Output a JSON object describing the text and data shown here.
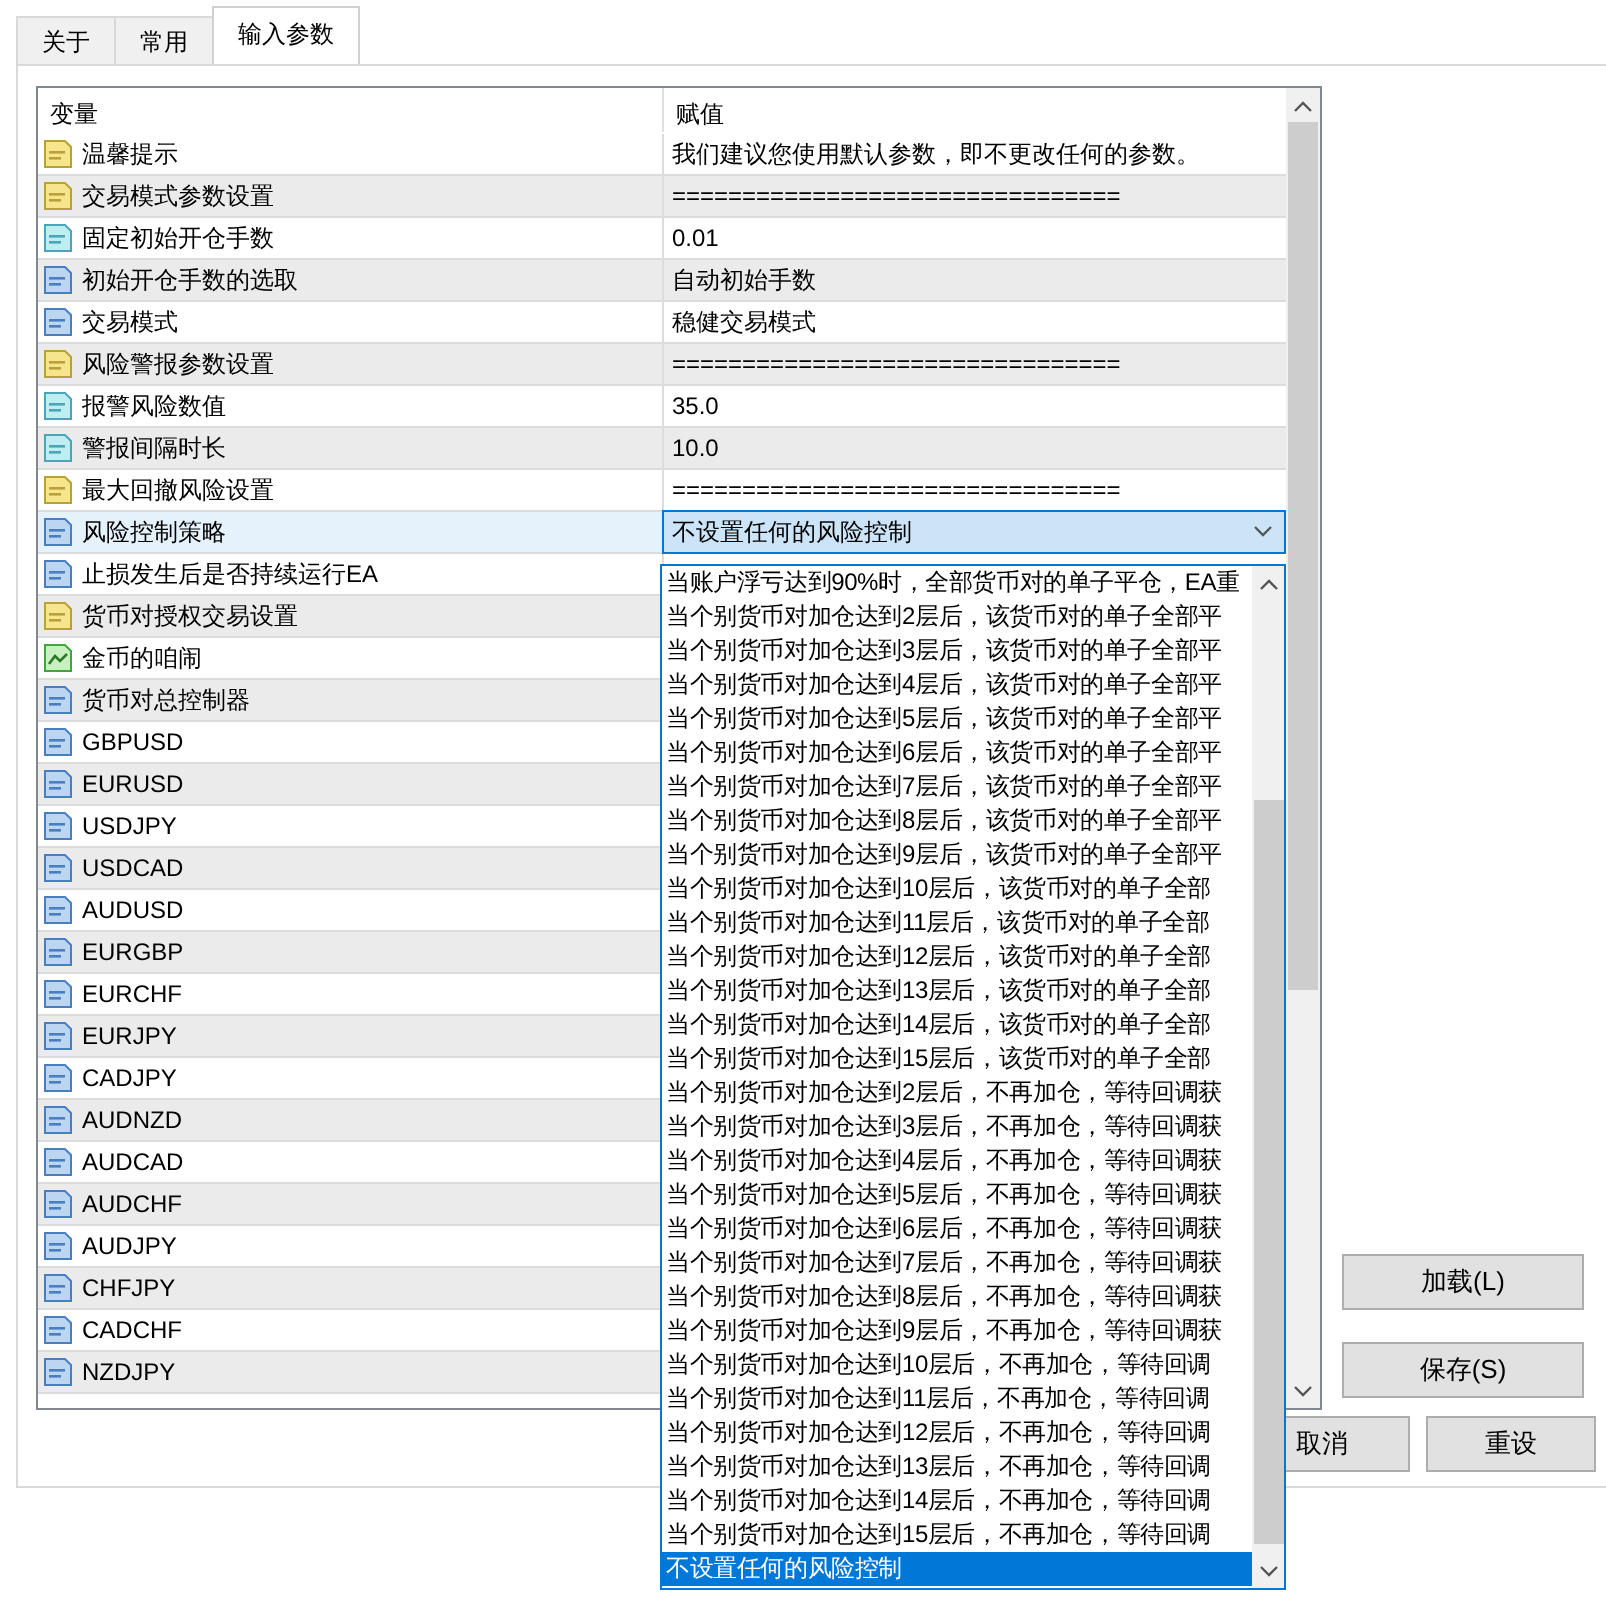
{
  "tabs": [
    {
      "label": "关于",
      "selected": false
    },
    {
      "label": "常用",
      "selected": false
    },
    {
      "label": "输入参数",
      "selected": true
    }
  ],
  "table": {
    "columns": [
      "变量",
      "赋值"
    ],
    "rows": [
      {
        "kind": "string",
        "name": "温馨提示",
        "value": "我们建议您使用默认参数，即不更改任何的参数。",
        "selected": false
      },
      {
        "kind": "string",
        "name": "交易模式参数设置",
        "value": "================================",
        "selected": false
      },
      {
        "kind": "double",
        "name": "固定初始开仓手数",
        "value": "0.01",
        "selected": false
      },
      {
        "kind": "enum",
        "name": "初始开仓手数的选取",
        "value": "自动初始手数",
        "selected": false
      },
      {
        "kind": "enum",
        "name": "交易模式",
        "value": "稳健交易模式",
        "selected": false
      },
      {
        "kind": "string",
        "name": "风险警报参数设置",
        "value": "================================",
        "selected": false
      },
      {
        "kind": "double",
        "name": "报警风险数值",
        "value": "35.0",
        "selected": false
      },
      {
        "kind": "double",
        "name": "警报间隔时长",
        "value": "10.0",
        "selected": false
      },
      {
        "kind": "string",
        "name": "最大回撤风险设置",
        "value": "================================",
        "selected": false
      },
      {
        "kind": "enum",
        "name": "风险控制策略",
        "value": "不设置任何的风险控制",
        "selected": true
      },
      {
        "kind": "enum",
        "name": "止损发生后是否持续运行EA",
        "selected": false
      },
      {
        "kind": "string",
        "name": "货币对授权交易设置",
        "selected": false
      },
      {
        "kind": "color",
        "name": "金币的咱闹",
        "selected": false
      },
      {
        "kind": "enum",
        "name": "货币对总控制器",
        "selected": false
      },
      {
        "kind": "enum",
        "name": "GBPUSD",
        "selected": false
      },
      {
        "kind": "enum",
        "name": "EURUSD",
        "selected": false
      },
      {
        "kind": "enum",
        "name": "USDJPY",
        "selected": false
      },
      {
        "kind": "enum",
        "name": "USDCAD",
        "selected": false
      },
      {
        "kind": "enum",
        "name": "AUDUSD",
        "selected": false
      },
      {
        "kind": "enum",
        "name": "EURGBP",
        "selected": false
      },
      {
        "kind": "enum",
        "name": "EURCHF",
        "selected": false
      },
      {
        "kind": "enum",
        "name": "EURJPY",
        "selected": false
      },
      {
        "kind": "enum",
        "name": "CADJPY",
        "selected": false
      },
      {
        "kind": "enum",
        "name": "AUDNZD",
        "selected": false
      },
      {
        "kind": "enum",
        "name": "AUDCAD",
        "selected": false
      },
      {
        "kind": "enum",
        "name": "AUDCHF",
        "selected": false
      },
      {
        "kind": "enum",
        "name": "AUDJPY",
        "selected": false
      },
      {
        "kind": "enum",
        "name": "CHFJPY",
        "selected": false
      },
      {
        "kind": "enum",
        "name": "CADCHF",
        "selected": false
      },
      {
        "kind": "enum",
        "name": "NZDJPY",
        "selected": false
      }
    ]
  },
  "dropdown_options": [
    {
      "label": "当账户浮亏达到90%时，全部货币对的单子平仓，EA重",
      "selected": false
    },
    {
      "label": "当个别货币对加仓达到2层后，该货币对的单子全部平",
      "selected": false
    },
    {
      "label": "当个别货币对加仓达到3层后，该货币对的单子全部平",
      "selected": false
    },
    {
      "label": "当个别货币对加仓达到4层后，该货币对的单子全部平",
      "selected": false
    },
    {
      "label": "当个别货币对加仓达到5层后，该货币对的单子全部平",
      "selected": false
    },
    {
      "label": "当个别货币对加仓达到6层后，该货币对的单子全部平",
      "selected": false
    },
    {
      "label": "当个别货币对加仓达到7层后，该货币对的单子全部平",
      "selected": false
    },
    {
      "label": "当个别货币对加仓达到8层后，该货币对的单子全部平",
      "selected": false
    },
    {
      "label": "当个别货币对加仓达到9层后，该货币对的单子全部平",
      "selected": false
    },
    {
      "label": "当个别货币对加仓达到10层后，该货币对的单子全部",
      "selected": false
    },
    {
      "label": "当个别货币对加仓达到11层后，该货币对的单子全部",
      "selected": false
    },
    {
      "label": "当个别货币对加仓达到12层后，该货币对的单子全部",
      "selected": false
    },
    {
      "label": "当个别货币对加仓达到13层后，该货币对的单子全部",
      "selected": false
    },
    {
      "label": "当个别货币对加仓达到14层后，该货币对的单子全部",
      "selected": false
    },
    {
      "label": "当个别货币对加仓达到15层后，该货币对的单子全部",
      "selected": false
    },
    {
      "label": "当个别货币对加仓达到2层后，不再加仓，等待回调获",
      "selected": false
    },
    {
      "label": "当个别货币对加仓达到3层后，不再加仓，等待回调获",
      "selected": false
    },
    {
      "label": "当个别货币对加仓达到4层后，不再加仓，等待回调获",
      "selected": false
    },
    {
      "label": "当个别货币对加仓达到5层后，不再加仓，等待回调获",
      "selected": false
    },
    {
      "label": "当个别货币对加仓达到6层后，不再加仓，等待回调获",
      "selected": false
    },
    {
      "label": "当个别货币对加仓达到7层后，不再加仓，等待回调获",
      "selected": false
    },
    {
      "label": "当个别货币对加仓达到8层后，不再加仓，等待回调获",
      "selected": false
    },
    {
      "label": "当个别货币对加仓达到9层后，不再加仓，等待回调获",
      "selected": false
    },
    {
      "label": "当个别货币对加仓达到10层后，不再加仓，等待回调",
      "selected": false
    },
    {
      "label": "当个别货币对加仓达到11层后，不再加仓，等待回调",
      "selected": false
    },
    {
      "label": "当个别货币对加仓达到12层后，不再加仓，等待回调",
      "selected": false
    },
    {
      "label": "当个别货币对加仓达到13层后，不再加仓，等待回调",
      "selected": false
    },
    {
      "label": "当个别货币对加仓达到14层后，不再加仓，等待回调",
      "selected": false
    },
    {
      "label": "当个别货币对加仓达到15层后，不再加仓，等待回调",
      "selected": false
    },
    {
      "label": "不设置任何的风险控制",
      "selected": true
    }
  ],
  "side_buttons": [
    "加载(L)",
    "保存(S)"
  ],
  "bottom_buttons": [
    "取消",
    "重设"
  ]
}
